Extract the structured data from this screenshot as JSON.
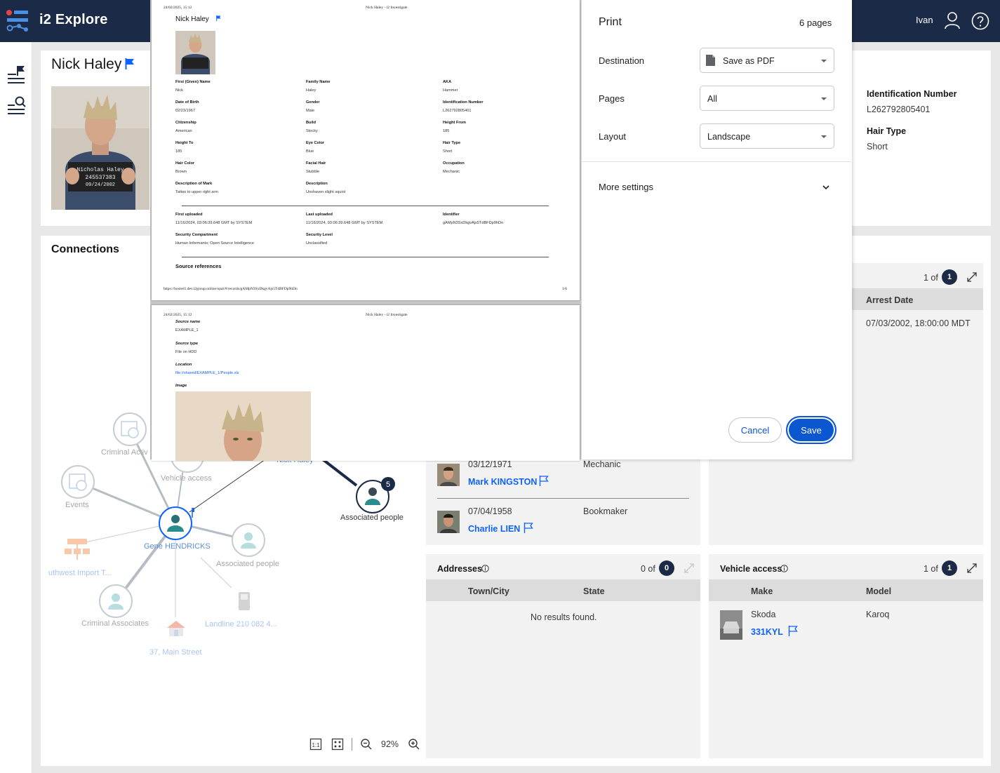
{
  "app": {
    "brand": "i2 Explore",
    "user": "Ivan"
  },
  "profile": {
    "name": "Nick Haley",
    "identification_number_label": "Identification Number",
    "identification_number": "L262792805401",
    "hair_type_label": "Hair Type",
    "hair_type": "Short",
    "placard_line1": "Nicholas Haley",
    "placard_line2": "245537383",
    "placard_line3": "09/24/2002"
  },
  "connections": {
    "title": "Connections",
    "center_node": "Gene HENDRICKS",
    "nodes": {
      "criminal_activity": "Criminal Activ",
      "vehicle_access": "Vehicle access",
      "events": "Events",
      "associated_people_faint": "Associated people",
      "southwest_import": "uthwest Import T...",
      "criminal_associates": "Criminal Associates",
      "landline": "Landline 210 082 4...",
      "main_street": "37, Main Street",
      "nick_haley": "Nick Haley",
      "associated_people": "Associated people",
      "associated_people_count": "5"
    },
    "zoom": "92%"
  },
  "arrests_panel": {
    "count_text": "1 of",
    "count": "1",
    "column": "Arrest Date",
    "value": "07/03/2002, 18:00:00 MDT"
  },
  "people_panel": {
    "rows": [
      {
        "date": "03/12/1971",
        "occupation": "Mechanic",
        "name": "Mark KINGSTON"
      },
      {
        "date": "07/04/1958",
        "occupation": "Bookmaker",
        "name": "Charlie LIEN"
      }
    ]
  },
  "addresses_panel": {
    "title": "Addresses",
    "count_text": "0 of",
    "count": "0",
    "columns": [
      "Town/City",
      "State"
    ],
    "empty_text": "No results found."
  },
  "vehicle_panel": {
    "title": "Vehicle access",
    "count_text": "1 of",
    "count": "1",
    "columns": [
      "Make",
      "Model"
    ],
    "make": "Skoda",
    "model": "Karoq",
    "plate": "331KYL"
  },
  "print_dialog": {
    "title": "Print",
    "pages_count": "6 pages",
    "destination_label": "Destination",
    "destination_value": "Save as PDF",
    "pages_label": "Pages",
    "pages_value": "All",
    "layout_label": "Layout",
    "layout_value": "Landscape",
    "more_settings": "More settings",
    "cancel": "Cancel",
    "save": "Save"
  },
  "preview": {
    "header_date": "24/02/2025, 15:12",
    "header_title": "Nick Haley - i2 Investigate",
    "name": "Nick Haley",
    "fields": [
      {
        "label": "First (Given) Name",
        "value": "Nick"
      },
      {
        "label": "Family Name",
        "value": "Haley"
      },
      {
        "label": "AKA",
        "value": "Hammer"
      },
      {
        "label": "Date of Birth",
        "value": "02/23/1967"
      },
      {
        "label": "Gender",
        "value": "Male"
      },
      {
        "label": "Identification Number",
        "value": "L262792805401"
      },
      {
        "label": "Citizenship",
        "value": "American"
      },
      {
        "label": "Build",
        "value": "Stocky"
      },
      {
        "label": "Height From",
        "value": "185"
      },
      {
        "label": "Height To",
        "value": "185"
      },
      {
        "label": "Eye Color",
        "value": "Blue"
      },
      {
        "label": "Hair Type",
        "value": "Short"
      },
      {
        "label": "Hair Color",
        "value": "Brown"
      },
      {
        "label": "Facial Hair",
        "value": "Stubble"
      },
      {
        "label": "Occupation",
        "value": "Mechanic"
      },
      {
        "label": "Description of Mark",
        "value": "Tattoo to upper right arm"
      },
      {
        "label": "Description",
        "value": "Unshaven slight squint"
      }
    ],
    "meta": [
      {
        "label": "First uploaded",
        "value": "11/16/2024, 03:06:39.648 GMT by SYSTEM"
      },
      {
        "label": "Last uploaded",
        "value": "11/16/2024, 03:06:39.648 GMT by SYSTEM"
      },
      {
        "label": "Identifier",
        "value": "gAMpN3SxDkgvAjs5TdBFDp9hDn"
      },
      {
        "label": "Security Compartment",
        "value": "Human Informants; Open Source Intelligence"
      },
      {
        "label": "Security Level",
        "value": "Unclassified"
      }
    ],
    "source_references": "Source references",
    "footer_url": "https://hosted1.dev.i2group.online/opal/#/records/gAMpN3SxDkgvAjs5TdBFDp9hDn",
    "footer_page": "1/6",
    "page2": {
      "source_name_label": "Source name",
      "source_name": "EXAMPLE_1",
      "source_type_label": "Source type",
      "source_type": "File on HDD",
      "location_label": "Location",
      "location": "file://shared/EXAMPLE_1/People.xls",
      "image_label": "Image"
    }
  },
  "colors": {
    "header": "#1b2a46",
    "accent": "#0f62fe",
    "save_button": "#0b57d0"
  }
}
